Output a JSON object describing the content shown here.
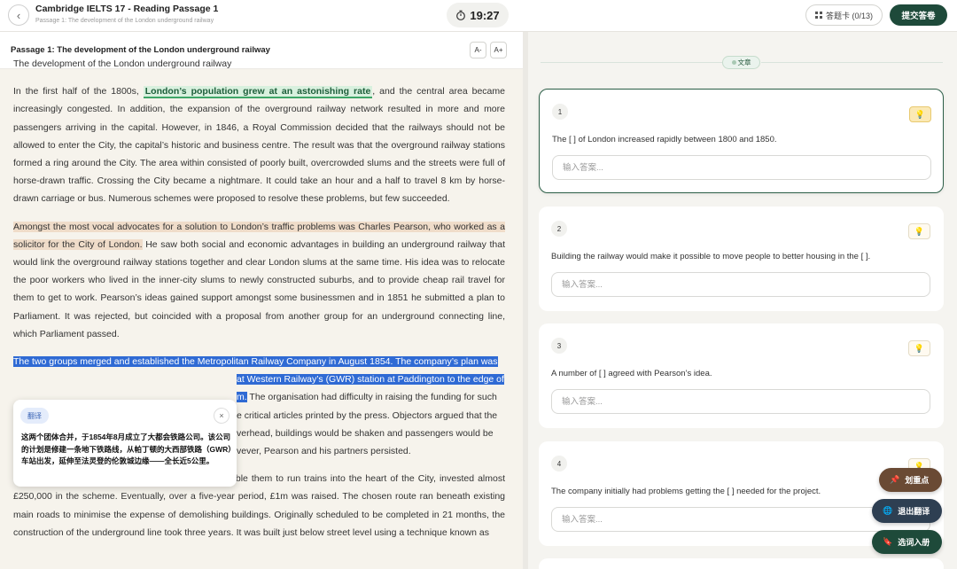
{
  "header": {
    "title": "Cambridge IELTS 17 - Reading Passage 1",
    "subtitle": "Passage 1: The development of the London underground railway",
    "timer": "19:27",
    "answer_card_label": "答题卡 (0/13)",
    "submit_label": "提交答卷"
  },
  "passage": {
    "heading": "Passage 1: The development of the London underground railway",
    "font_decrease_label": "A-",
    "font_increase_label": "A+",
    "title": "The development of the London underground railway",
    "p1": {
      "before": "In the first half of the 1800s, ",
      "highlight": "London’s population grew at an astonishing rate",
      "after": ", and the central area became increasingly congested. In addition, the expansion of the overground railway network resulted in more and more passengers arriving in the capital. However, in 1846, a Royal Commission decided that the railways should not be allowed to enter the City, the capital’s historic and business centre. The result was that the overground railway stations formed a ring around the City. The area within consisted of poorly built, overcrowded slums and the streets were full of horse-drawn traffic. Crossing the City became a nightmare. It could take an hour and a half to travel 8 km by horse-drawn carriage or bus. Numerous schemes were proposed to resolve these problems, but few succeeded."
    },
    "p2": {
      "highlight": "Amongst the most vocal advocates for a solution to London’s traffic problems was Charles Pearson, who worked as a solicitor for the City of London.",
      "after": " He saw both social and economic advantages in building an underground railway that would link the overground railway stations together and clear London slums at the same time. His idea was to relocate the poor workers who lived in the inner-city slums to newly constructed suburbs, and to provide cheap rail travel for them to get to work. Pearson’s ideas gained support amongst some businessmen and in 1851 he submitted a plan to Parliament. It was rejected, but coincided with a proposal from another group for an underground connecting line, which Parliament passed."
    },
    "p3": {
      "sel1": "The two groups merged and established the Metropolitan Railway Company in August 1854. The company’s plan was",
      "sel2": "at Western Railway’s (GWR) station at Paddington to the edge of",
      "sel3": "m.",
      "line3": " The organisation had difficulty in raising the funding for such",
      "line4": "e critical articles printed by the press. Objectors argued that the",
      "line5": "verhead, buildings would be shaken and passengers would be",
      "line6": "vever, Pearson and his partners persisted."
    },
    "p4": "The GWR, aware that the new line would finally enable them to run trains into the heart of the City, invested almost £250,000 in the scheme. Eventually, over a five-year period, £1m was raised. The chosen route ran beneath existing main roads to minimise the expense of demolishing buildings. Originally scheduled to be completed in 21 months, the construction of the underground line took three years. It was built just below street level using a technique known as"
  },
  "translation_popup": {
    "tag": "翻译",
    "close": "×",
    "text": "这两个团体合并，于1854年8月成立了大都会铁路公司。该公司的计划是修建一条地下铁路线，从帕丁顿的大西部铁路（GWR）车站出发，延伸至法灵登的伦敦城边缘——全长近5公里。"
  },
  "questions": {
    "section_label": "文章",
    "items": [
      {
        "number": "1",
        "text": "The [ ] of London increased rapidly between 1800 and 1850.",
        "placeholder": "输入答案..."
      },
      {
        "number": "2",
        "text": "Building the railway would make it possible to move people to better housing in the [ ].",
        "placeholder": "输入答案..."
      },
      {
        "number": "3",
        "text": "A number of [ ] agreed with Pearson’s idea.",
        "placeholder": "输入答案..."
      },
      {
        "number": "4",
        "text": "The company initially had problems getting the [ ] needed for the project.",
        "placeholder": "输入答案..."
      }
    ]
  },
  "fabs": {
    "mark_label": "划重点",
    "exit_translate_label": "退出翻译",
    "vocab_label": "选词入册"
  },
  "icons": {
    "back": "chevron-left-icon",
    "timer": "stopwatch-icon",
    "answer_card": "grid-icon",
    "hint": "lightbulb-icon",
    "mark": "pin-icon",
    "translate": "globe-icon",
    "vocab": "bookmark-icon"
  },
  "colors": {
    "primary": "#1e4a3a",
    "highlight_green": "#d8f0de",
    "highlight_tan": "#efdcc9",
    "selection_blue": "#2f6ad4",
    "mark_button": "#6a4a34",
    "translate_button": "#2e3f52"
  }
}
